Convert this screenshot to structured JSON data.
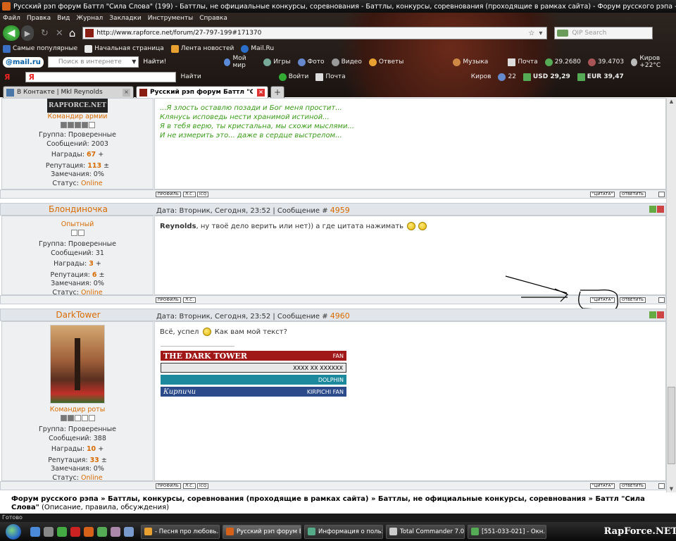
{
  "window": {
    "title": "Русский рэп форум Баттл \"Сила Слова\" (199) - Баттлы, не официальные конкурсы, соревнования - Баттлы, конкурсы, соревнования (проходящие в рамках сайта) - Форум русского рэпа - Mozi..."
  },
  "menu": [
    "Файл",
    "Правка",
    "Вид",
    "Журнал",
    "Закладки",
    "Инструменты",
    "Справка"
  ],
  "nav": {
    "url": "http://www.rapforce.net/forum/27-797-199#171370",
    "search_placeholder": "QIP Search"
  },
  "bookmarks": [
    "Самые популярные",
    "Начальная страница",
    "Лента новостей",
    "Mail.Ru"
  ],
  "mailbar": {
    "logo": "@mail.ru",
    "search_placeholder": "Поиск в интернете",
    "go": "Найти!",
    "items": [
      "Мой мир",
      "Игры",
      "Фото",
      "Видео",
      "Ответы",
      "Музыка",
      "Почта",
      "29.2680",
      "39.4703",
      "Киров +22°C"
    ]
  },
  "yabar": {
    "logo": "Я",
    "input": "Я",
    "go": "Найти",
    "items": [
      "Войти",
      "Почта",
      "Киров",
      "22",
      "USD 29,29",
      "EUR 39,47"
    ]
  },
  "tabs": [
    {
      "label": "В Контакте | Mkl Reynolds",
      "close": "×"
    },
    {
      "label": "Русский рэп форум Баттл \"Сила ...",
      "close": "×"
    },
    {
      "label": "+"
    }
  ],
  "posts": [
    {
      "rank": "Командир армии",
      "stars_filled": 4,
      "stars_total": 5,
      "group": "Группа: Проверенные",
      "messages": "Сообщений: 2003",
      "awards_label": "Награды:",
      "awards": "67",
      "rep_label": "Репутация:",
      "rep": "113",
      "warnings": "Замечания: 0%",
      "status_label": "Статус:",
      "status": "Online",
      "lines": [
        "...Я злость оставлю позади и Бог меня простит...",
        "Клянусь исповедь нести хранимой истиной...",
        "Я в тебя верю, ты кристальна, мы схожи мыслями...",
        "И не измерить это... даже в сердце выстрелом..."
      ]
    },
    {
      "nick": "Блондиночка",
      "date": "Дата: Вторник, Сегодня, 23:52 | Сообщение #",
      "num": "4959",
      "rank": "Опытный",
      "stars_filled": 0,
      "stars_total": 2,
      "group": "Группа: Проверенные",
      "messages": "Сообщений: 31",
      "awards_label": "Награды:",
      "awards": "3",
      "rep_label": "Репутация:",
      "rep": "6",
      "warnings": "Замечания: 0%",
      "status_label": "Статус:",
      "status": "Online",
      "author": "Reynolds",
      "text": ", ну твоё дело верить или нет)) а где цитата нажимать"
    },
    {
      "nick": "DarkTower",
      "date": "Дата: Вторник, Сегодня, 23:52 | Сообщение #",
      "num": "4960",
      "rank": "Командир роты",
      "stars_filled": 2,
      "stars_total": 5,
      "group": "Группа: Проверенные",
      "messages": "Сообщений: 388",
      "awards_label": "Награды:",
      "awards": "10",
      "rep_label": "Репутация:",
      "rep": "33",
      "warnings": "Замечания: 0%",
      "status_label": "Статус:",
      "status": "Online",
      "text1": "Всё, успел",
      "text2": "Как вам мой текст?",
      "banners": [
        {
          "left": "THE DARK TOWER",
          "right": "FAN",
          "color": "#a01818"
        },
        {
          "left": "",
          "right": "XXXX XX XXXXXX",
          "color": "#e8e8e8"
        },
        {
          "left": "",
          "right": "DOLPHIN",
          "color": "#1c8a9c"
        },
        {
          "left": "Кирпичи",
          "right": "KIRPICHI FAN",
          "color": "#2a4a8a"
        }
      ]
    }
  ],
  "post_buttons": {
    "profile": "ПРОФИЛЬ",
    "pm": "Л.С.",
    "icq": "ICQ",
    "quote": "\"ЦИТАТА\"",
    "reply": "ОТВЕТИТЬ"
  },
  "breadcrumb": {
    "bold": "Форум русского рэпа » Баттлы, конкурсы, соревнования (проходящие в рамках сайта) » Баттлы, не официальные конкурсы, соревнования » Баттл \"Сила Слова\"",
    "normal": " (Описание, правила, обсуждения)"
  },
  "status": "Готово",
  "taskbar": [
    "- Песня про любовь...",
    "Русский рэп форум Б...",
    "Информация о польз...",
    "Total Commander 7.0...",
    "[551-033-021] - Окн..."
  ],
  "watermark": "RapForce.NET"
}
